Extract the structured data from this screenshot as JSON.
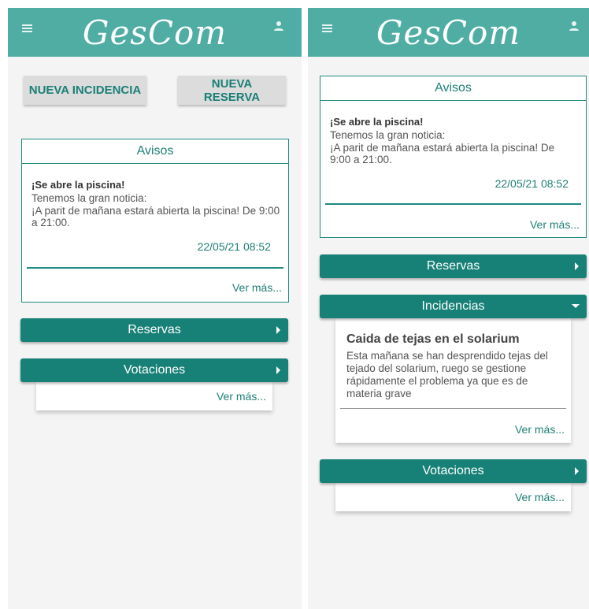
{
  "app": {
    "title": "GesCom"
  },
  "screen1": {
    "buttons": {
      "new_incident": "NUEVA INCIDENCIA",
      "new_reservation": "NUEVA RESERVA"
    },
    "notices": {
      "title": "Avisos",
      "item_title": "¡Se abre la piscina!",
      "item_line1": "Tenemos la gran noticia:",
      "item_line2": "¡A parit de mañana estará abierta la piscina! De 9:00 a 21:00.",
      "item_date": "22/05/21 08:52",
      "more": "Ver más..."
    },
    "reservations": {
      "label": "Reservas"
    },
    "votes": {
      "label": "Votaciones",
      "more": "Ver más..."
    }
  },
  "screen2": {
    "notices": {
      "title": "Avisos",
      "item_title": "¡Se abre la piscina!",
      "item_line1": "Tenemos la gran noticia:",
      "item_line2": "¡A parit de mañana estará abierta la piscina! De 9:00 a 21:00.",
      "item_date": "22/05/21 08:52",
      "more": "Ver más..."
    },
    "reservations": {
      "label": "Reservas"
    },
    "incidents": {
      "label": "Incidencias",
      "item_title": "Caida de tejas en el solarium",
      "item_body": "Esta mañana se han desprendido tejas del tejado del solarium, ruego se gestione rápidamente el problema ya que es de materia grave",
      "more": "Ver más..."
    },
    "votes": {
      "label": "Votaciones",
      "more": "Ver más..."
    }
  },
  "icons": {
    "menu": "menu-icon",
    "user": "user-icon",
    "expand": "caret-right-icon",
    "collapse": "caret-down-icon"
  },
  "colors": {
    "appbar": "#4fada3",
    "accent": "#178077",
    "text_accent": "#1e7f75",
    "background": "#f4f4f4"
  }
}
